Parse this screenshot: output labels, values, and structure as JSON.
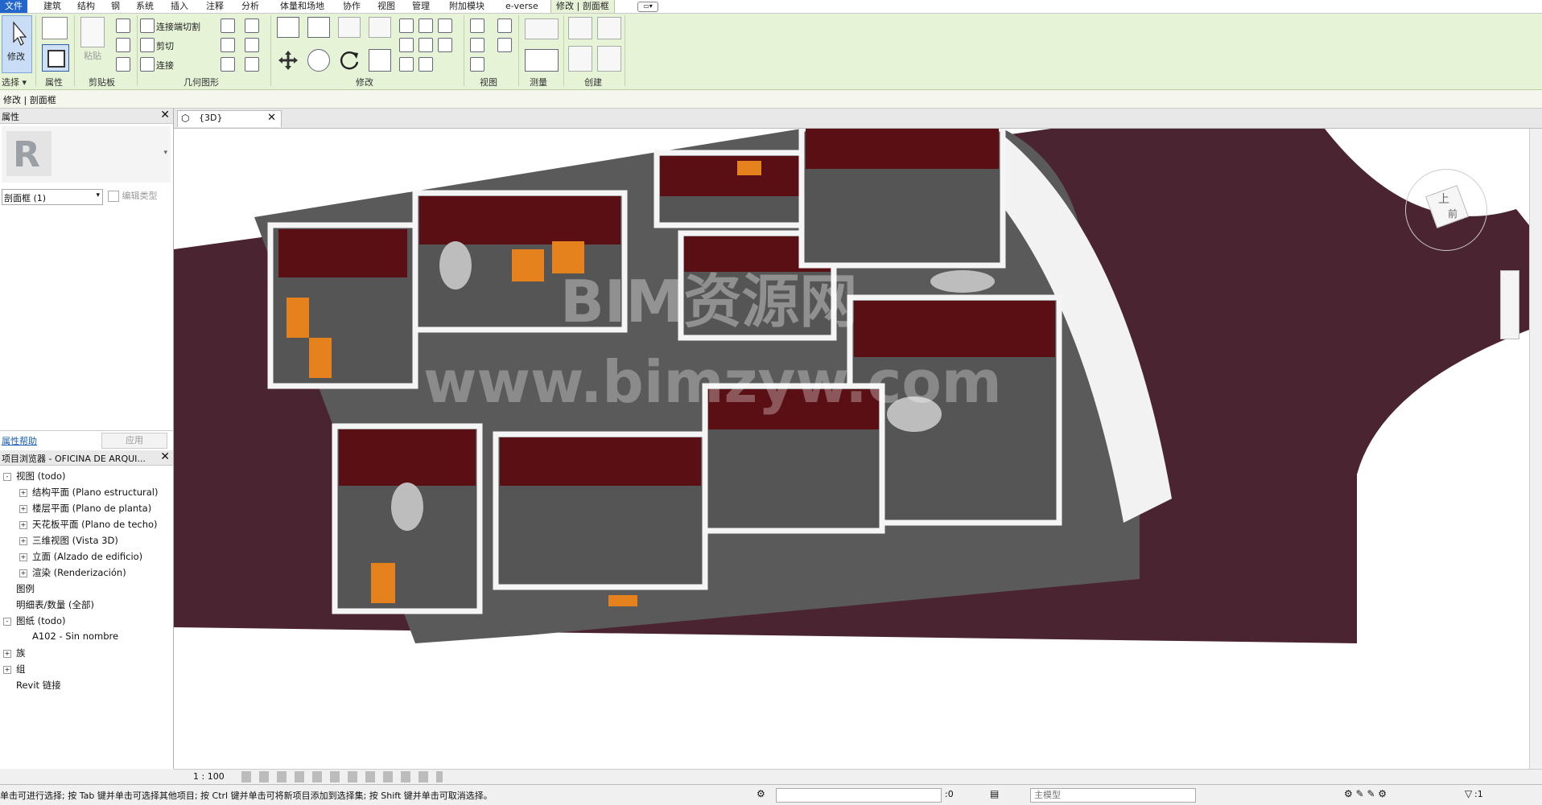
{
  "menu": [
    "文件",
    "建筑",
    "结构",
    "钢",
    "系统",
    "插入",
    "注释",
    "分析",
    "体量和场地",
    "协作",
    "视图",
    "管理",
    "附加模块",
    "e-verse",
    "修改 | 剖面框"
  ],
  "ribbon": {
    "select_label": "修改",
    "select_panel": "选择 ▾",
    "props_panel": "属性",
    "clipboard_paste": "粘贴",
    "clipboard_panel": "剪贴板",
    "geom_cut_join": "连接端切割",
    "geom_cut": "剪切",
    "geom_join": "连接",
    "geom_panel": "几何图形",
    "modify_panel": "修改",
    "view_panel": "视图",
    "measure_panel": "测量",
    "create_panel": "创建"
  },
  "context": "修改 | 剖面框",
  "properties": {
    "title": "属性",
    "type_value": "剖面框 (1)",
    "edit_type": "编辑类型",
    "help": "属性帮助",
    "apply": "应用"
  },
  "browser": {
    "title": "项目浏览器 - OFICINA DE ARQUI...",
    "items": [
      {
        "label": "视图 (todo)",
        "level": 0,
        "toggle": "-"
      },
      {
        "label": "结构平面 (Plano estructural)",
        "level": 1,
        "toggle": "+"
      },
      {
        "label": "楼层平面 (Plano de planta)",
        "level": 1,
        "toggle": "+"
      },
      {
        "label": "天花板平面 (Plano de techo)",
        "level": 1,
        "toggle": "+"
      },
      {
        "label": "三维视图 (Vista 3D)",
        "level": 1,
        "toggle": "+"
      },
      {
        "label": "立面 (Alzado de edificio)",
        "level": 1,
        "toggle": "+"
      },
      {
        "label": "渲染 (Renderización)",
        "level": 1,
        "toggle": "+"
      },
      {
        "label": "图例",
        "level": 0,
        "toggle": ""
      },
      {
        "label": "明细表/数量 (全部)",
        "level": 0,
        "toggle": ""
      },
      {
        "label": "图纸 (todo)",
        "level": 0,
        "toggle": "-"
      },
      {
        "label": "A102 - Sin nombre",
        "level": 1,
        "toggle": ""
      },
      {
        "label": "族",
        "level": 0,
        "toggle": "+"
      },
      {
        "label": "组",
        "level": 0,
        "toggle": "+"
      },
      {
        "label": "Revit 链接",
        "level": 0,
        "toggle": ""
      }
    ]
  },
  "view": {
    "tab_label": "{3D}",
    "scale": "1 : 100",
    "watermark_1": "BIM资源网",
    "watermark_2": "www.bimzyw.com",
    "cube_top": "上",
    "cube_front": "前"
  },
  "status": {
    "hint": "单击可进行选择; 按 Tab 键并单击可选择其他项目; 按 Ctrl 键并单击可将新项目添加到选择集; 按 Shift 键并单击可取消选择。",
    "count": ":0",
    "model": "主模型",
    "filter": ":1"
  },
  "colors": {
    "ribbon_bg": "#e6f3d7",
    "wall_dark": "#5a0f14",
    "floor": "#555555",
    "site": "#4a2430",
    "furniture_orange": "#e6821e"
  }
}
